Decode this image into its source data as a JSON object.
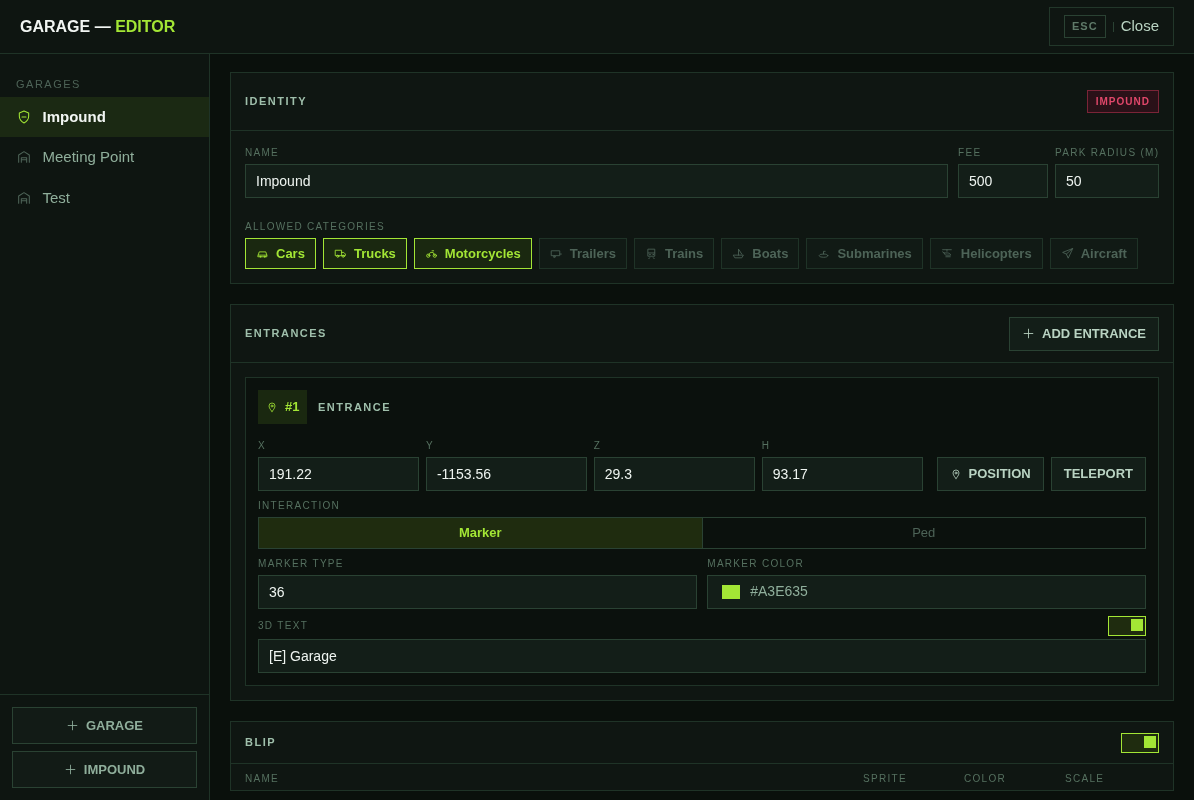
{
  "header": {
    "title": "GARAGE —",
    "title_accent": "EDITOR",
    "close_key": "ESC",
    "close_label": "Close"
  },
  "sidebar": {
    "heading": "GARAGES",
    "items": [
      {
        "label": "Impound",
        "kind": "impound",
        "selected": true
      },
      {
        "label": "Meeting Point",
        "kind": "garage",
        "selected": false
      },
      {
        "label": "Test",
        "kind": "garage",
        "selected": false
      }
    ],
    "buttons": [
      {
        "label": "GARAGE"
      },
      {
        "label": "IMPOUND"
      }
    ]
  },
  "identity": {
    "title": "IDENTITY",
    "badge": "IMPOUND",
    "fields": [
      {
        "label": "NAME",
        "value": "Impound"
      },
      {
        "label": "FEE",
        "value": "500"
      },
      {
        "label": "PARK RADIUS (M)",
        "value": "50"
      }
    ],
    "categories_label": "ALLOWED CATEGORIES",
    "categories": [
      {
        "label": "Cars",
        "kind": "car",
        "selected": true
      },
      {
        "label": "Trucks",
        "kind": "truck",
        "selected": true
      },
      {
        "label": "Motorcycles",
        "kind": "motorcycle",
        "selected": true
      },
      {
        "label": "Trailers",
        "kind": "trailer",
        "selected": false
      },
      {
        "label": "Trains",
        "kind": "train",
        "selected": false
      },
      {
        "label": "Boats",
        "kind": "boat",
        "selected": false
      },
      {
        "label": "Submarines",
        "kind": "submarine",
        "selected": false
      },
      {
        "label": "Helicopters",
        "kind": "helicopter",
        "selected": false
      },
      {
        "label": "Aircraft",
        "kind": "aircraft",
        "selected": false
      }
    ]
  },
  "entrances": {
    "title": "ENTRANCES",
    "add_label": "ADD ENTRANCE",
    "items": [
      {
        "number": "#1",
        "title": "ENTRANCE",
        "coords": [
          {
            "label": "X",
            "value": "191.22"
          },
          {
            "label": "Y",
            "value": "-1153.56"
          },
          {
            "label": "Z",
            "value": "29.3"
          },
          {
            "label": "H",
            "value": "93.17"
          }
        ],
        "position_label": "POSITION",
        "teleport_label": "TELEPORT",
        "interaction_label": "INTERACTION",
        "interaction_options": [
          {
            "label": "Marker",
            "selected": true
          },
          {
            "label": "Ped",
            "selected": false
          }
        ],
        "marker_type": {
          "label": "MARKER TYPE",
          "value": "36"
        },
        "marker_color": {
          "label": "MARKER COLOR",
          "value": "#A3E635",
          "color": "#a3e635"
        },
        "text_3d": {
          "label": "3D TEXT",
          "on": true,
          "value": "[E] Garage"
        }
      }
    ]
  },
  "blip": {
    "title": "BLIP",
    "on": true,
    "columns": [
      "NAME",
      "SPRITE",
      "COLOR",
      "SCALE"
    ]
  }
}
